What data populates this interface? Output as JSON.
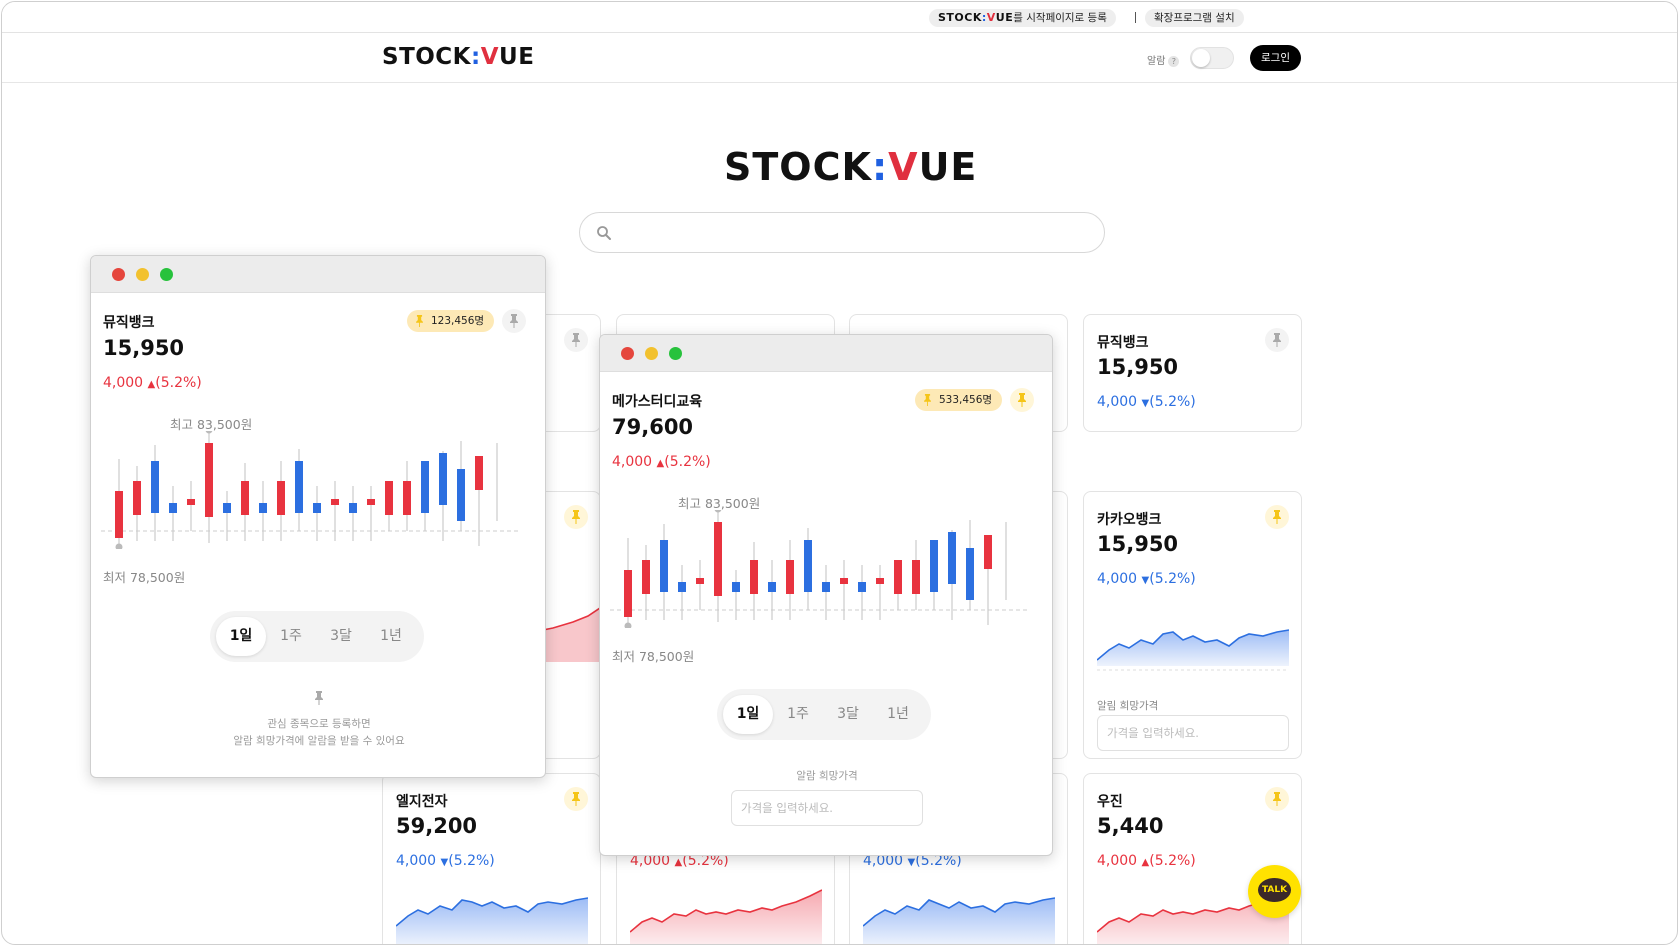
{
  "topbar": {
    "brand": {
      "stock": "STOCK",
      "colon": ":",
      "v": "V",
      "ue": "UE"
    },
    "register_suffix": "를 시작페이지로 등록",
    "install_extension": "확장프로그램 설치"
  },
  "header": {
    "logo": {
      "stock": "STOCK",
      "colon": ":",
      "v": "V",
      "ue": "UE"
    },
    "alarm_label": "알람",
    "alarm_help": "?",
    "alarm_toggle_on": false,
    "login_label": "로그인"
  },
  "hero": {
    "logo": {
      "stock": "STOCK",
      "colon": ":",
      "v": "V",
      "ue": "UE"
    },
    "search_icon": "search-icon",
    "search_placeholder": ""
  },
  "colors": {
    "up": "#e8333f",
    "down": "#2c6fe0",
    "blue_brand": "#2060e0",
    "red_brand": "#e0303f",
    "badge": "#fde9b6",
    "pin_gold": "#f5c518"
  },
  "cards": [
    {
      "id": "musicbank-right",
      "name": "뮤직뱅크",
      "price": "15,950",
      "change": "4,000",
      "arrow": "▼",
      "pct": "(5.2%)",
      "direction": "down",
      "pinned": false
    },
    {
      "id": "kakaobank",
      "name": "카카오뱅크",
      "price": "15,950",
      "change": "4,000",
      "arrow": "▼",
      "pct": "(5.2%)",
      "direction": "down",
      "pinned": true,
      "alarm_label": "알림 희망가격",
      "alarm_placeholder": "가격을 입력하세요."
    },
    {
      "id": "lgelec",
      "name": "엘지전자",
      "price": "59,200",
      "change": "4,000",
      "arrow": "▼",
      "pct": "(5.2%)",
      "direction": "down",
      "pinned": true
    },
    {
      "id": "row3-col2",
      "change": "4,000",
      "arrow": "▲",
      "pct": "(5.2%)",
      "direction": "up"
    },
    {
      "id": "row3-col3",
      "change": "4,000",
      "arrow": "▼",
      "pct": "(5.2%)",
      "direction": "down"
    },
    {
      "id": "woojin",
      "name": "우진",
      "price": "5,440",
      "change": "4,000",
      "arrow": "▲",
      "pct": "(5.2%)",
      "direction": "up",
      "pinned": true
    }
  ],
  "popup_left": {
    "name": "뮤직뱅크",
    "price": "15,950",
    "change": "4,000",
    "arrow": "▲",
    "pct": "(5.2%)",
    "watchers": "123,456명",
    "high_label": "최고 83,500원",
    "low_label": "최저 78,500원",
    "periods": [
      "1일",
      "1주",
      "3달",
      "1년"
    ],
    "active_period": "1일",
    "note_line1": "관심 종목으로 등록하면",
    "note_line2": "알람 희망가격에 알람을 받을 수 있어요"
  },
  "popup_center": {
    "name": "메가스터디교육",
    "price": "79,600",
    "change": "4,000",
    "arrow": "▲",
    "pct": "(5.2%)",
    "watchers": "533,456명",
    "high_label": "최고 83,500원",
    "low_label": "최저 78,500원",
    "periods": [
      "1일",
      "1주",
      "3달",
      "1년"
    ],
    "active_period": "1일",
    "alarm_label": "알람 희망가격",
    "alarm_placeholder": "가격을 입력하세요."
  },
  "talk_button": "TALK"
}
